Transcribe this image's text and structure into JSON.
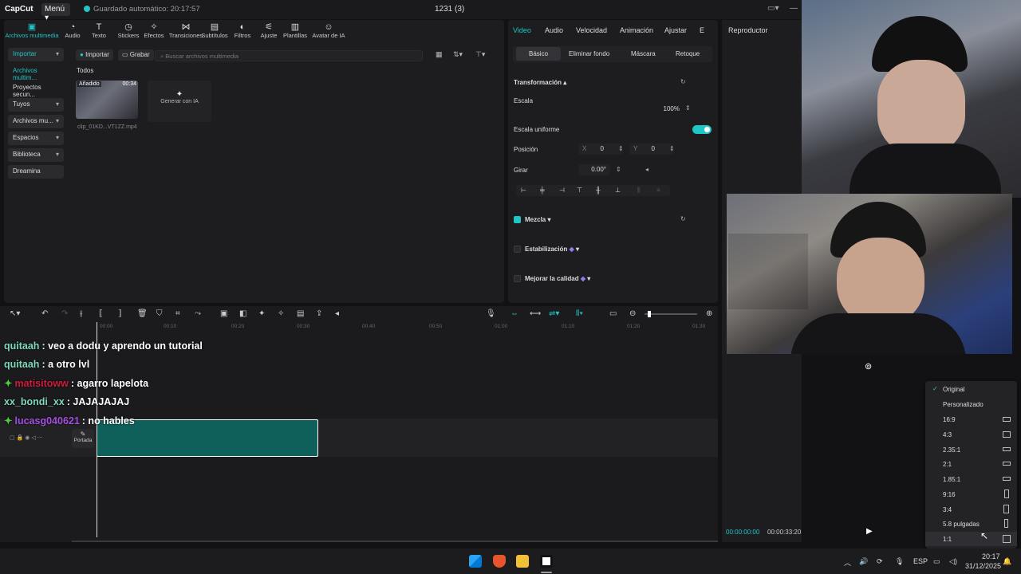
{
  "app": {
    "logo": "CapCut",
    "menu_label": "Menú",
    "autosave": "Guardado automático: 20:17:57",
    "project_name": "1231 (3)"
  },
  "tools": [
    {
      "label": "Archivos multimedia",
      "icon": "media-icon",
      "active": true
    },
    {
      "label": "Audio",
      "icon": "audio-icon"
    },
    {
      "label": "Texto",
      "icon": "text-icon"
    },
    {
      "label": "Stickers",
      "icon": "sticker-icon"
    },
    {
      "label": "Efectos",
      "icon": "effects-icon"
    },
    {
      "label": "Transiciones",
      "icon": "transitions-icon"
    },
    {
      "label": "Subtítulos",
      "icon": "subtitles-icon"
    },
    {
      "label": "Filtros",
      "icon": "filters-icon"
    },
    {
      "label": "Ajuste",
      "icon": "adjust-icon"
    },
    {
      "label": "Plantillas",
      "icon": "templates-icon"
    },
    {
      "label": "Avatar de IA",
      "icon": "ai-avatar-icon"
    }
  ],
  "sidebar": [
    {
      "label": "Importar",
      "boxed": true,
      "active": true
    },
    {
      "label": "Archivos multim...",
      "active": true
    },
    {
      "label": "Proyectos secun..."
    },
    {
      "label": "Tuyos",
      "boxed": true
    },
    {
      "label": "Archivos mu...",
      "boxed": true
    },
    {
      "label": "Espacios",
      "boxed": true
    },
    {
      "label": "Biblioteca",
      "boxed": true
    },
    {
      "label": "Dreamina",
      "boxed": true
    }
  ],
  "media": {
    "import_label": "Importar",
    "record_label": "Grabar",
    "search_placeholder": "Buscar archivos multimedia",
    "filter_all": "Todos",
    "clip_badge": "Añadido",
    "clip_duration": "00:34",
    "clip_name": "clip_01KD...VT1ZZ.mp4",
    "generate_ai": "Generar con IA"
  },
  "props": {
    "tabs": [
      "Video",
      "Audio",
      "Velocidad",
      "Animación",
      "Ajustar",
      "E"
    ],
    "subtabs": [
      "Básico",
      "Eliminar fondo",
      "Máscara",
      "Retoque"
    ],
    "transform": "Transformación",
    "scale_label": "Escala",
    "scale_value": "100%",
    "uniform_scale": "Escala uniforme",
    "position_label": "Posición",
    "pos_x_label": "X",
    "pos_x": "0",
    "pos_y_label": "Y",
    "pos_y": "0",
    "rotate_label": "Girar",
    "rotate_value": "0.00°",
    "blend": "Mezcla",
    "stabilize": "Estabilización",
    "quality": "Mejorar la calidad"
  },
  "player": {
    "title": "Reproductor",
    "current_time": "00:00:00:00",
    "total_time": "00:00:33:20"
  },
  "timeline": {
    "ticks": [
      "00:00",
      "00:10",
      "00:20",
      "00:30",
      "00:40",
      "00:50",
      "01:00",
      "01:10",
      "01:20",
      "01:30"
    ],
    "cover_label": "Portada"
  },
  "chat": [
    {
      "user": "quitaah",
      "text": ": veo a dodu y aprendo un tutorial",
      "color": "#7fd8b8",
      "gem": false
    },
    {
      "user": "quitaah",
      "text": ": a otro lvl",
      "color": "#7fd8b8",
      "gem": false
    },
    {
      "user": "matisitoww",
      "text": ": agarro lapelota",
      "color": "#d01c3a",
      "gem": true
    },
    {
      "user": "xx_bondi_xx",
      "text": ": JAJAJAJAJ",
      "color": "#7fd8b8",
      "gem": false
    },
    {
      "user": "lucasg040621",
      "text": ": no hables",
      "color": "#a350e0",
      "gem": true
    }
  ],
  "ratio_menu": [
    {
      "label": "Original",
      "checked": true
    },
    {
      "label": "Personalizado"
    },
    {
      "label": "16:9",
      "shape": "wide"
    },
    {
      "label": "4:3",
      "shape": "box"
    },
    {
      "label": "2.35:1",
      "shape": "wide"
    },
    {
      "label": "2:1",
      "shape": "wide"
    },
    {
      "label": "1.85:1",
      "shape": "wide"
    },
    {
      "label": "9:16",
      "shape": "tall"
    },
    {
      "label": "3:4",
      "shape": "tall"
    },
    {
      "label": "5.8 pulgadas",
      "shape": "tall"
    },
    {
      "label": "1:1",
      "shape": "box",
      "hover": true
    }
  ],
  "taskbar": {
    "lang": "ESP",
    "time": "20:17",
    "date": "31/12/2025"
  },
  "colors": {
    "accent": "#20c5c5",
    "clip": "#0f5f5a"
  }
}
